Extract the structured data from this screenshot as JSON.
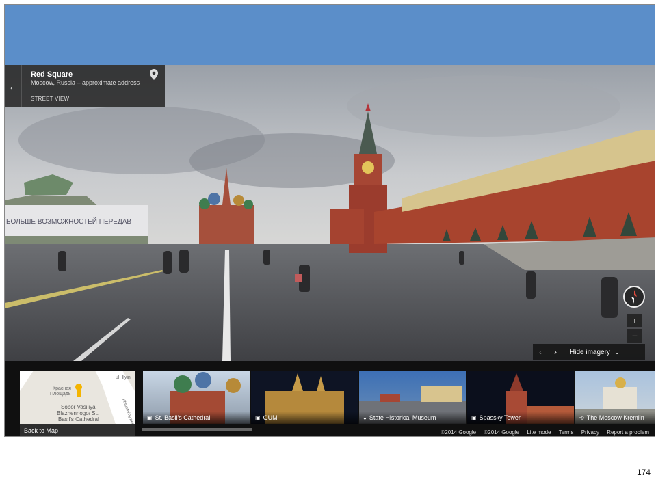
{
  "infocard": {
    "back_icon": "←",
    "title": "Red Square",
    "subtitle": "Moscow, Russia – approximate address",
    "label": "STREET VIEW"
  },
  "controls": {
    "zoom_in": "+",
    "zoom_out": "−",
    "prev": "‹",
    "next": "›",
    "hide_imagery": "Hide imagery",
    "hide_chevron": "⌄"
  },
  "panorama": {
    "banner_text": "БОЛЬШЕ ВОЗМОЖНОСТЕЙ ПЕРЕДАВ"
  },
  "map_thumb": {
    "labels": [
      "Красная",
      "Площадь",
      "Sobor Vasiliya",
      "Blazhennogo/ St.",
      "Basil's Cathedral",
      "ul. Ilyin",
      "Khrustal'ny per"
    ],
    "back_label": "Back to Map"
  },
  "thumbnails": [
    {
      "label": "St. Basil's Cathedral",
      "icon": "photo-icon"
    },
    {
      "label": "GUM",
      "icon": "photo-icon"
    },
    {
      "label": "State Historical Museum",
      "icon": "panorama-icon"
    },
    {
      "label": "Spassky Tower",
      "icon": "photo-icon"
    },
    {
      "label": "The Moscow Kremlin",
      "icon": "360-icon"
    }
  ],
  "footer": [
    "©2014 Google",
    "©2014 Google",
    "Lite mode",
    "Terms",
    "Privacy",
    "Report a problem"
  ],
  "page_number": "174",
  "colors": {
    "band": "#5b8ec9",
    "kremlin_wall": "#a8442e",
    "sky": "#b9bcc2"
  }
}
